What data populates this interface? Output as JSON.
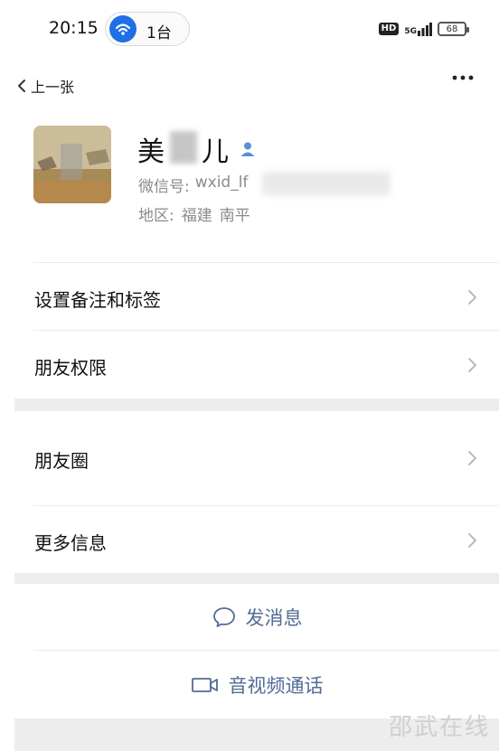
{
  "status_bar": {
    "time": "20:15",
    "hotspot_count": "1台",
    "hd_label": "HD",
    "network_label": "5G",
    "battery_level": "68",
    "accent_color": "#1f6fe5"
  },
  "nav": {
    "back_label": "上一张",
    "more_icon": "more-dots-icon"
  },
  "profile": {
    "nickname_first": "美",
    "nickname_last": "儿",
    "wxid_label": "微信号:",
    "wxid_value": "wxid_lf",
    "region_label": "地区:",
    "region_province": "福建",
    "region_city": "南平",
    "verified_icon": "person-icon"
  },
  "menu": {
    "items": [
      {
        "label": "设置备注和标签"
      },
      {
        "label": "朋友权限"
      },
      {
        "label": "朋友圈"
      },
      {
        "label": "更多信息"
      }
    ]
  },
  "actions": {
    "send_message": "发消息",
    "video_call": "音视频通话",
    "link_color": "#526c96"
  },
  "watermark": "邵武在线"
}
